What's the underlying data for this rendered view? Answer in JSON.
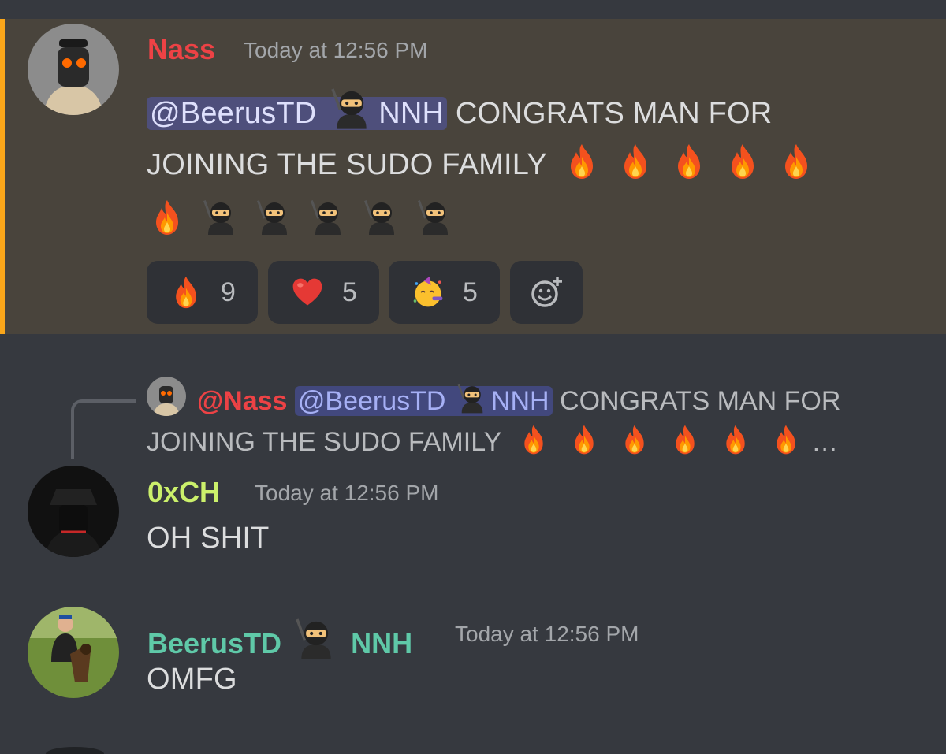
{
  "colors": {
    "highlight_bg": "#49443c",
    "highlight_bar": "#faa61a",
    "background": "#36393f",
    "mention_bg": "#4f5486",
    "nass_color": "#ed4245",
    "oxch_color": "#cbf06b",
    "beerus_color": "#5fc9a8"
  },
  "messages": [
    {
      "author": "Nass",
      "timestamp": "Today at 12:56 PM",
      "mention": "@BeerusTD",
      "mention_suffix": "NNH",
      "text_line1": "CONGRATS MAN FOR",
      "text_line2": "JOINING THE SUDO FAMILY",
      "emojis_line2": [
        "fire",
        "fire",
        "fire",
        "fire",
        "fire"
      ],
      "emojis_line3": [
        "fire",
        "ninja",
        "ninja",
        "ninja",
        "ninja",
        "ninja"
      ],
      "reactions": [
        {
          "emoji": "fire",
          "count": "9"
        },
        {
          "emoji": "heart",
          "count": "5"
        },
        {
          "emoji": "partying-face",
          "count": "5"
        },
        {
          "emoji": "add-reaction-icon",
          "count": ""
        }
      ]
    },
    {
      "reply_to": {
        "author": "@Nass",
        "mention": "@BeerusTD",
        "mention_suffix": "NNH",
        "text_line1": "CONGRATS MAN FOR",
        "text_line2": "JOINING THE SUDO FAMILY",
        "ellipsis": "…"
      },
      "author": "0xCH",
      "timestamp": "Today at 12:56 PM",
      "text": "OH SHIT"
    },
    {
      "author": "BeerusTD",
      "author_suffix": "NNH",
      "timestamp": "Today at 12:56 PM",
      "text": "OMFG"
    }
  ]
}
